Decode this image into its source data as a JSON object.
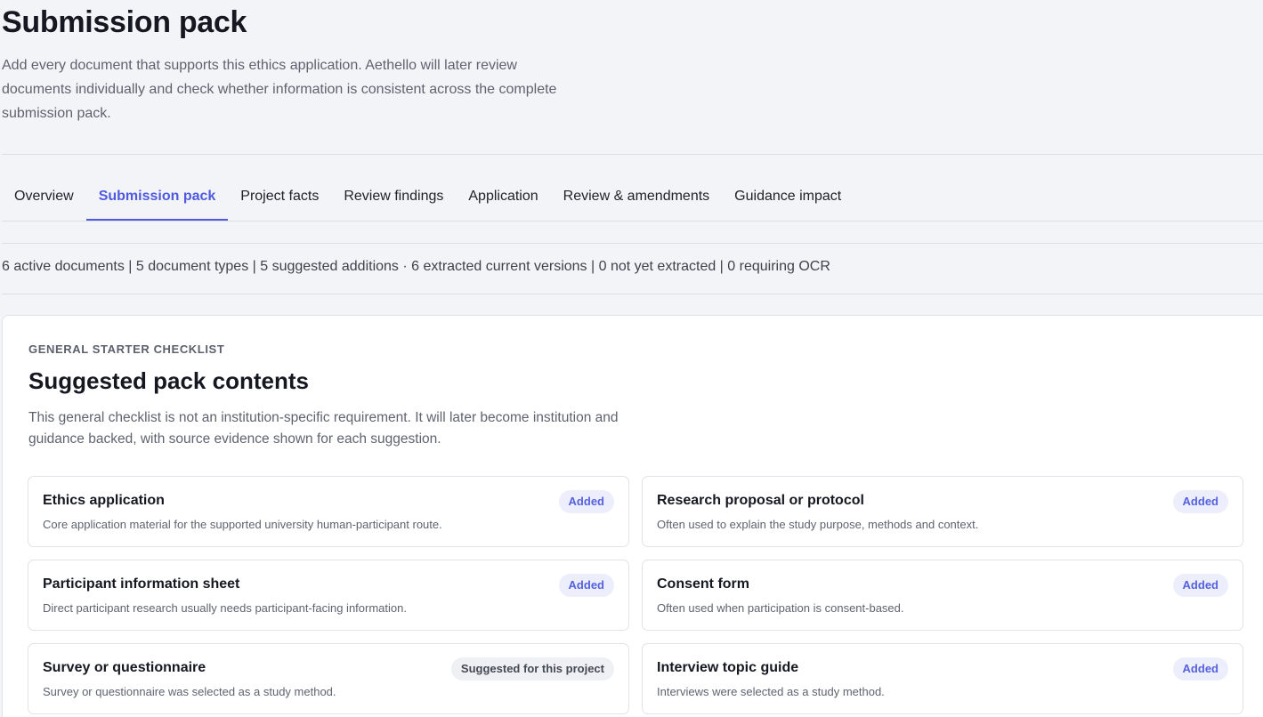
{
  "header": {
    "title": "Submission pack",
    "description": "Add every document that supports this ethics application. Aethello will later review documents individually and check whether information is consistent across the complete submission pack."
  },
  "tabs": [
    {
      "label": "Overview",
      "active": false
    },
    {
      "label": "Submission pack",
      "active": true
    },
    {
      "label": "Project facts",
      "active": false
    },
    {
      "label": "Review findings",
      "active": false
    },
    {
      "label": "Application",
      "active": false
    },
    {
      "label": "Review & amendments",
      "active": false
    },
    {
      "label": "Guidance impact",
      "active": false
    }
  ],
  "stats": "6 active documents | 5 document types | 5 suggested additions · 6 extracted current versions | 0 not yet extracted | 0 requiring OCR",
  "checklist": {
    "eyebrow": "GENERAL STARTER CHECKLIST",
    "title": "Suggested pack contents",
    "description": "This general checklist is not an institution-specific requirement. It will later become institution and guidance backed, with source evidence shown for each suggestion.",
    "items": [
      {
        "title": "Ethics application",
        "description": "Core application material for the supported university human-participant route.",
        "status": "Added"
      },
      {
        "title": "Research proposal or protocol",
        "description": "Often used to explain the study purpose, methods and context.",
        "status": "Added"
      },
      {
        "title": "Participant information sheet",
        "description": "Direct participant research usually needs participant-facing information.",
        "status": "Added"
      },
      {
        "title": "Consent form",
        "description": "Often used when participation is consent-based.",
        "status": "Added"
      },
      {
        "title": "Survey or questionnaire",
        "description": "Survey or questionnaire was selected as a study method.",
        "status": "Suggested for this project"
      },
      {
        "title": "Interview topic guide",
        "description": "Interviews were selected as a study method.",
        "status": "Added"
      }
    ]
  },
  "colors": {
    "accent": "#4f5ae0",
    "background": "#f3f4f7",
    "badge_added_bg": "#eceefb",
    "badge_suggested_bg": "#eef0f3"
  }
}
